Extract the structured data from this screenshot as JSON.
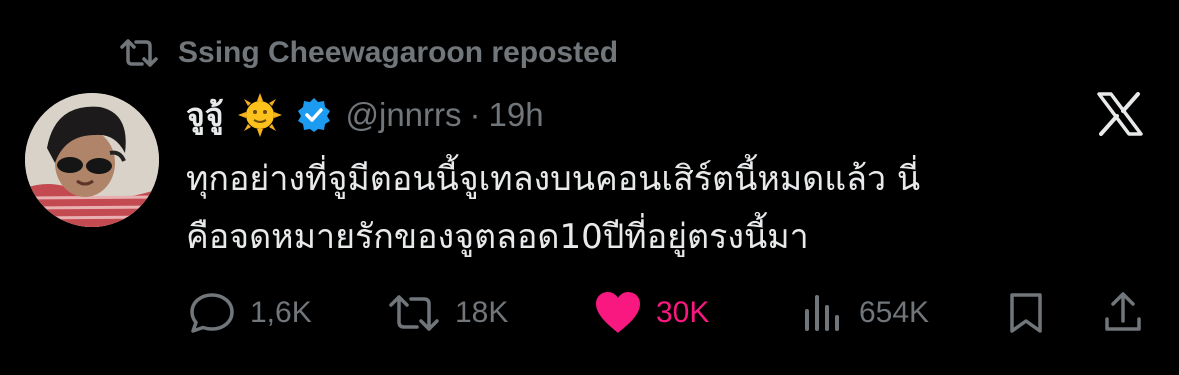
{
  "repost": {
    "icon": "repost-icon",
    "text": "Ssing Cheewagaroon reposted"
  },
  "author": {
    "display_name": "จูจู้",
    "emoji": "sun-with-face-emoji",
    "verified_icon": "verified-badge-icon",
    "handle": "@jnnrrs",
    "separator": "·",
    "time": "19h"
  },
  "platform_icon": "x-logo-icon",
  "tweet": {
    "lines": [
      "ทุกอย่างที่จูมีตอนนี้จูเทลงบนคอนเสิร์ตนี้หมดแล้ว นี่",
      "คือจดหมายรักของจูตลอด10ปีที่อยู่ตรงนี้มา"
    ]
  },
  "actions": {
    "replies": {
      "icon": "reply-icon",
      "count": "1,6K"
    },
    "reposts": {
      "icon": "repost-icon",
      "count": "18K"
    },
    "likes": {
      "icon": "heart-icon",
      "count": "30K",
      "color": "#f91880"
    },
    "views": {
      "icon": "views-chart-icon",
      "count": "654K"
    },
    "bookmark": {
      "icon": "bookmark-icon"
    },
    "share": {
      "icon": "share-icon"
    }
  },
  "colors": {
    "background": "#000000",
    "text": "#e7e9ea",
    "muted": "#71767b",
    "verified": "#1d9bf0",
    "like": "#f91880"
  }
}
